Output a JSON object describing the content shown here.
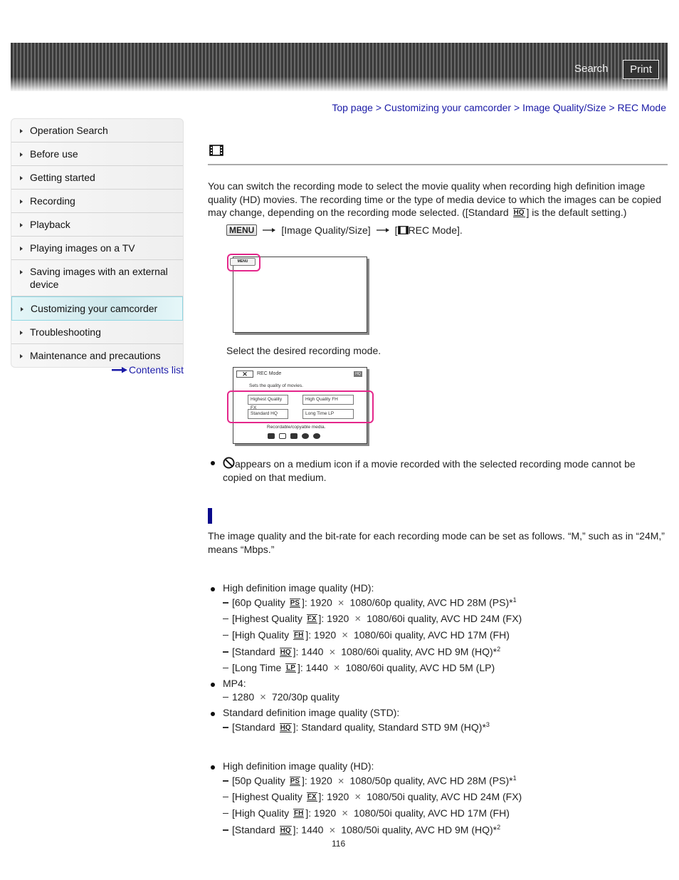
{
  "header": {
    "search_label": "Search",
    "print_label": "Print"
  },
  "sidebar": {
    "items": [
      {
        "label": "Operation Search",
        "selected": false
      },
      {
        "label": "Before use",
        "selected": false
      },
      {
        "label": "Getting started",
        "selected": false
      },
      {
        "label": "Recording",
        "selected": false
      },
      {
        "label": "Playback",
        "selected": false
      },
      {
        "label": "Playing images on a TV",
        "selected": false
      },
      {
        "label": "Saving images with an external device",
        "selected": false
      },
      {
        "label": "Customizing your camcorder",
        "selected": true
      },
      {
        "label": "Troubleshooting",
        "selected": false
      },
      {
        "label": "Maintenance and precautions",
        "selected": false
      }
    ],
    "contents_link": "Contents list"
  },
  "breadcrumb": [
    "Top page",
    "Customizing your camcorder",
    "Image Quality/Size",
    "REC Mode"
  ],
  "breadcrumb_separator": ">",
  "intro": {
    "text_before_badge": "You can switch the recording mode to select the movie quality when recording high definition image quality (HD) movies. The recording time or the type of media device to which the images can be copied may change, depending on the recording mode selected. ([Standard",
    "badge": "HQ",
    "text_after_badge": "] is the default setting.)"
  },
  "nav_path": {
    "menu_key": "MENU",
    "step1": "[Image Quality/Size]",
    "step2_prefix": "[",
    "step2": "REC Mode]."
  },
  "screen1": {
    "menu_button": "MENU"
  },
  "step_caption": "Select the desired recording mode.",
  "screen2": {
    "close": "✕",
    "title": "REC Mode",
    "corner_badge": "HQ",
    "subtitle": "Sets the quality of movies.",
    "options": [
      "Highest Quality FX",
      "High Quality FH",
      "Standard HQ",
      "Long Time LP"
    ],
    "footer": "Recordable/copyable media."
  },
  "note": {
    "line1": "appears on a medium icon if a movie recorded with the selected recording mode cannot be",
    "line2": "copied on that medium."
  },
  "bitrate_intro": {
    "line1": "The image quality and the bit-rate for each recording mode can be set as follows. “M,” such as in “24M,”",
    "line2": "means “Mbps.”"
  },
  "group_60": {
    "hd_heading": "High definition image quality (HD):",
    "hd_items": [
      {
        "pre": "[60p Quality",
        "badge": "PS",
        "res": "]: 1920",
        "post": "1080/60p quality, AVC HD 28M (PS)*",
        "sup": "1"
      },
      {
        "pre": "[Highest Quality",
        "badge": "FX",
        "res": "]: 1920",
        "post": "1080/60i quality, AVC HD 24M (FX)",
        "sup": ""
      },
      {
        "pre": "[High Quality",
        "badge": "FH",
        "res": "]: 1920",
        "post": "1080/60i quality, AVC HD 17M (FH)",
        "sup": ""
      },
      {
        "pre": "[Standard",
        "badge": "HQ",
        "res": "]: 1440",
        "post": "1080/60i quality, AVC HD 9M (HQ)*",
        "sup": "2"
      },
      {
        "pre": "[Long Time",
        "badge": "LP",
        "res": "]: 1440",
        "post": "1080/60i quality, AVC HD 5M (LP)",
        "sup": ""
      }
    ],
    "mp4_heading": "MP4:",
    "mp4_item": {
      "res": "1280",
      "post": "720/30p quality"
    },
    "std_heading": "Standard definition image quality (STD):",
    "std_item": {
      "pre": "[Standard",
      "badge": "HQ",
      "post": "]: Standard quality, Standard STD 9M (HQ)*",
      "sup": "3"
    }
  },
  "group_50": {
    "hd_heading": "High definition image quality (HD):",
    "hd_items": [
      {
        "pre": "[50p Quality",
        "badge": "PS",
        "res": "]: 1920",
        "post": "1080/50p quality, AVC HD 28M (PS)*",
        "sup": "1"
      },
      {
        "pre": "[Highest Quality",
        "badge": "FX",
        "res": "]: 1920",
        "post": "1080/50i quality, AVC HD 24M (FX)",
        "sup": ""
      },
      {
        "pre": "[High Quality",
        "badge": "FH",
        "res": "]: 1920",
        "post": "1080/50i quality, AVC HD 17M (FH)",
        "sup": ""
      },
      {
        "pre": "[Standard",
        "badge": "HQ",
        "res": "]: 1440",
        "post": "1080/50i quality, AVC HD 9M (HQ)*",
        "sup": "2"
      }
    ]
  },
  "times_symbol": "×",
  "page_number": "116",
  "colors": {
    "link": "#1a1aa6",
    "highlight": "#e4278b",
    "section_bar": "#0a0a8c"
  }
}
